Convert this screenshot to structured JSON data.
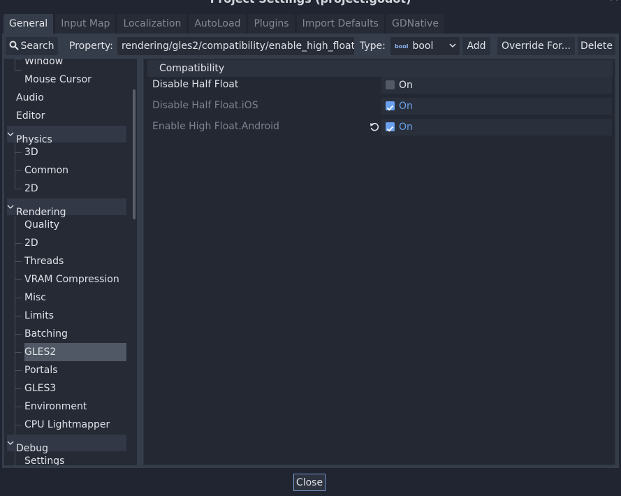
{
  "window": {
    "title": "Project Settings (project.godot)"
  },
  "tabs": [
    "General",
    "Input Map",
    "Localization",
    "AutoLoad",
    "Plugins",
    "Import Defaults",
    "GDNative"
  ],
  "toolbar": {
    "search_label": "Search",
    "property_label": "Property:",
    "property_value": "rendering/gles2/compatibility/enable_high_float",
    "type_label": "Type:",
    "type_icon_text": "bool",
    "type_value": "bool",
    "add_label": "Add",
    "override_label": "Override For...",
    "delete_label": "Delete"
  },
  "tree": {
    "items": [
      "Window",
      "Mouse Cursor",
      "Audio",
      "Editor",
      "Physics",
      "3D",
      "Common",
      "2D",
      "Rendering",
      "Quality",
      "2D",
      "Threads",
      "VRAM Compression",
      "Misc",
      "Limits",
      "Batching",
      "GLES2",
      "Portals",
      "GLES3",
      "Environment",
      "CPU Lightmapper",
      "Debug",
      "Settings"
    ],
    "selected": "GLES2"
  },
  "inspector": {
    "section": "Compatibility",
    "properties": [
      {
        "name": "Disable Half Float",
        "value": "On",
        "checked": false,
        "dim": false
      },
      {
        "name": "Disable Half Float.iOS",
        "value": "On",
        "checked": true,
        "dim": true
      },
      {
        "name": "Enable High Float.Android",
        "value": "On",
        "checked": true,
        "dim": true,
        "revert": true
      }
    ]
  },
  "footer": {
    "close_label": "Close"
  },
  "colors": {
    "accent": "#6aa0ee",
    "panel": "#363d4a",
    "background": "#202531"
  }
}
